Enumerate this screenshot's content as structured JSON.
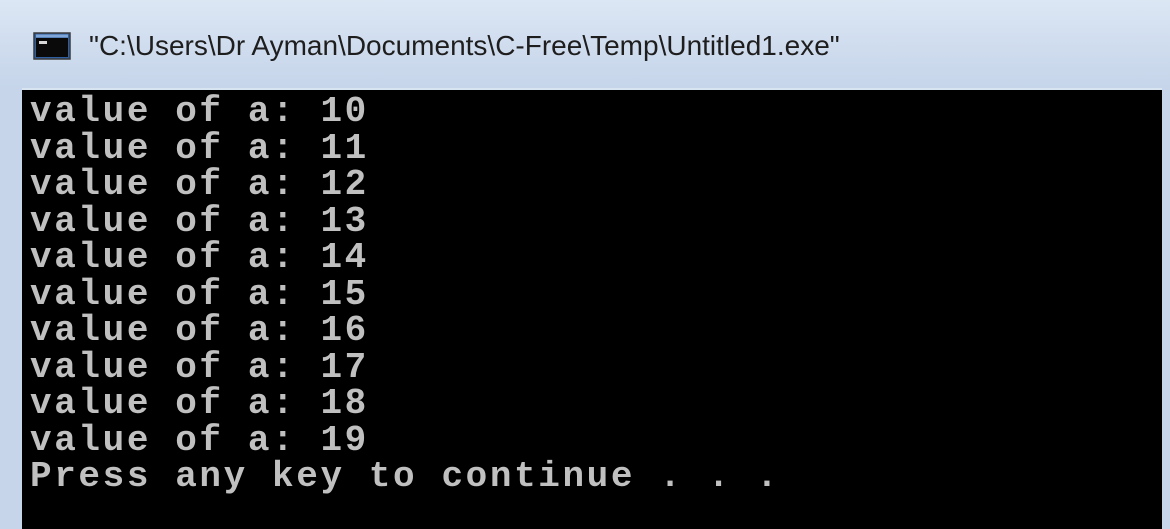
{
  "window": {
    "title": "\"C:\\Users\\Dr Ayman\\Documents\\C-Free\\Temp\\Untitled1.exe\"",
    "icon": "console-app-icon"
  },
  "console": {
    "lines": [
      "value of a: 10",
      "value of a: 11",
      "value of a: 12",
      "value of a: 13",
      "value of a: 14",
      "value of a: 15",
      "value of a: 16",
      "value of a: 17",
      "value of a: 18",
      "value of a: 19",
      "Press any key to continue . . ."
    ],
    "text_color": "#c0c0c0",
    "background_color": "#000000"
  }
}
